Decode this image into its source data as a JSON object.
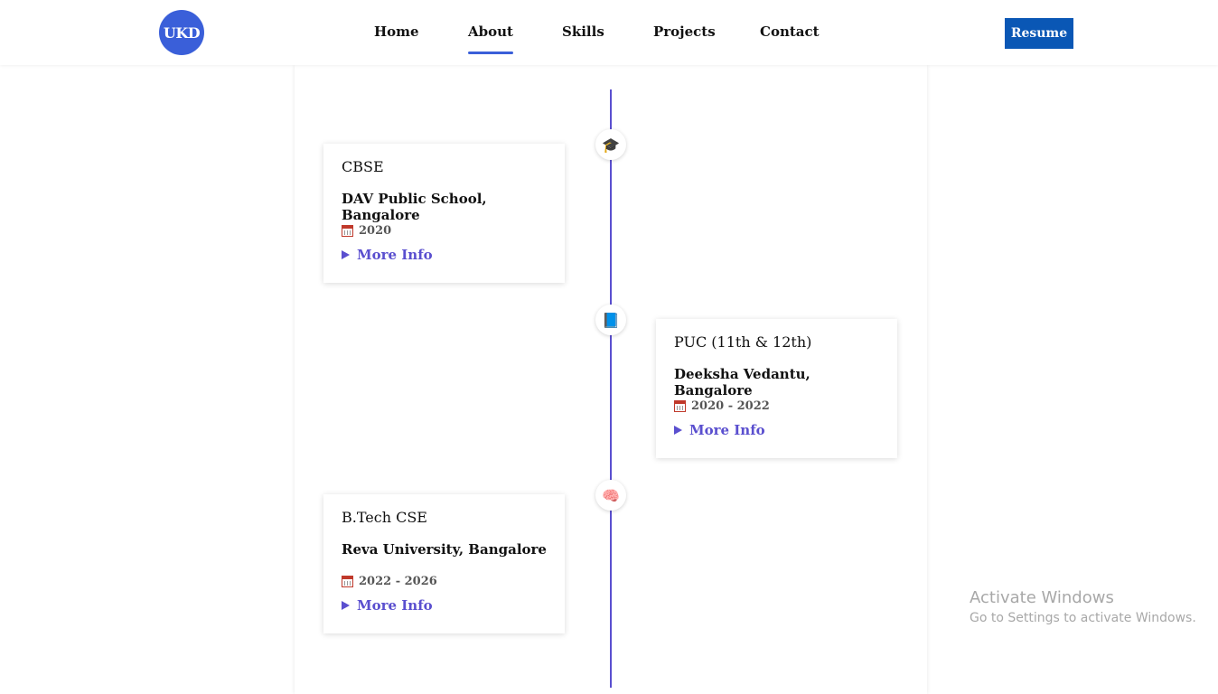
{
  "header": {
    "logo_text": "UKD",
    "nav": [
      {
        "label": "Home"
      },
      {
        "label": "About"
      },
      {
        "label": "Skills"
      },
      {
        "label": "Projects"
      },
      {
        "label": "Contact"
      }
    ],
    "active_nav": "About",
    "resume_label": "Resume"
  },
  "timeline": [
    {
      "icon": "graduation-cap-icon",
      "icon_glyph": "🎓",
      "degree": "CBSE",
      "school": "DAV Public School, Bangalore",
      "date": "2020",
      "more_label": "More Info"
    },
    {
      "icon": "book-icon",
      "icon_glyph": "📘",
      "degree": "PUC (11th & 12th)",
      "school": "Deeksha Vedantu, Bangalore",
      "date": "2020 - 2022",
      "more_label": "More Info"
    },
    {
      "icon": "brain-icon",
      "icon_glyph": "🧠",
      "degree": "B.Tech CSE",
      "school": "Reva University, Bangalore",
      "date": "2022 - 2026",
      "more_label": "More Info"
    }
  ],
  "watermark": {
    "title": "Activate Windows",
    "subtitle": "Go to Settings to activate Windows."
  },
  "colors": {
    "accent": "#5a4fcf",
    "logo_bg": "#3a5fd9",
    "resume_bg": "#0a57b5"
  }
}
